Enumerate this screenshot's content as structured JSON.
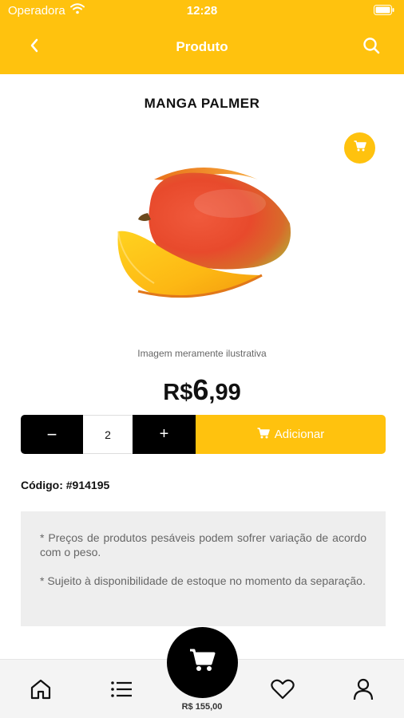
{
  "status": {
    "carrier": "Operadora",
    "time": "12:28"
  },
  "header": {
    "title": "Produto"
  },
  "product": {
    "name": "MANGA PALMER",
    "image_caption": "Imagem meramente ilustrativa",
    "price_currency": "R$",
    "price_integer": "6",
    "price_decimal": ",99",
    "code": "Código: #914195"
  },
  "quantity": {
    "minus": "−",
    "value": "2",
    "plus": "+"
  },
  "actions": {
    "add_label": "Adicionar"
  },
  "notices": [
    "* Preços de produtos pesáveis podem sofrer variação de acordo com o peso.",
    "* Sujeito à disponibilidade de estoque no momento da separação."
  ],
  "tabbar": {
    "cart_total": "R$ 155,00"
  },
  "colors": {
    "accent": "#FFC20E",
    "dark": "#000000",
    "notice_bg": "#EEEEEE"
  },
  "icons": {
    "back": "chevron-left-icon",
    "search": "search-icon",
    "cart": "cart-icon",
    "home": "home-icon",
    "list": "list-icon",
    "favorite": "heart-icon",
    "user": "user-icon"
  }
}
